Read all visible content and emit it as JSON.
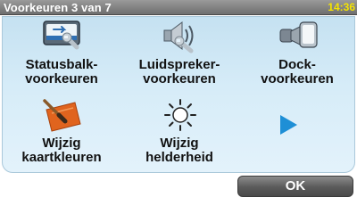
{
  "header": {
    "title": "Voorkeuren 3 van 7",
    "time": "14:36"
  },
  "tiles": [
    {
      "icon": "status-bar-wrench-icon",
      "line1": "Statusbalk-",
      "line2": "voorkeuren"
    },
    {
      "icon": "speaker-wrench-icon",
      "line1": "Luidspreker-",
      "line2": "voorkeuren"
    },
    {
      "icon": "dock-icon",
      "line1": "Dock-",
      "line2": "voorkeuren"
    },
    {
      "icon": "paint-brush-map-icon",
      "line1": "Wijzig",
      "line2": "kaartkleuren"
    },
    {
      "icon": "sun-brightness-icon",
      "line1": "Wijzig",
      "line2": "helderheid"
    },
    {
      "icon": "next-arrow-icon"
    }
  ],
  "footer": {
    "ok_label": "OK"
  },
  "colors": {
    "title_bar": "#7d7d7d",
    "clock": "#f5e400",
    "panel": "#d2e9f6",
    "next_arrow": "#1e8fd6"
  }
}
